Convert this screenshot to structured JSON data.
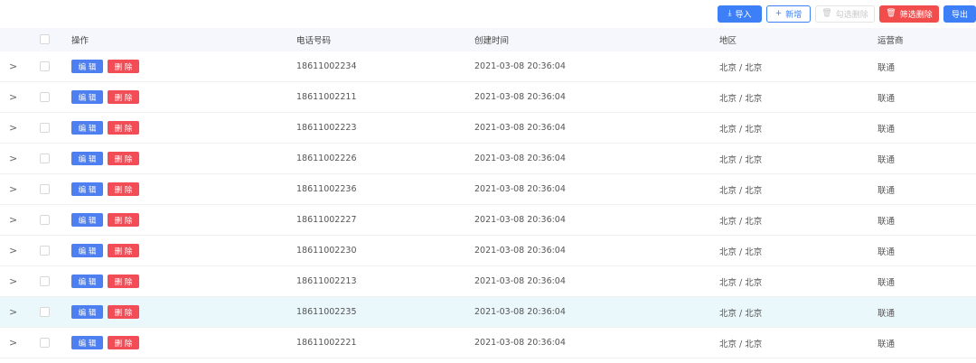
{
  "toolbar": {
    "import_label": "导入",
    "add_label": "新增",
    "checked_delete_label": "勾选删除",
    "filter_delete_label": "筛选删除",
    "export_label": "导出"
  },
  "table": {
    "headers": {
      "ops": "操作",
      "phone": "电话号码",
      "created": "创建时间",
      "region": "地区",
      "carrier": "运营商"
    },
    "edit_label": "编 辑",
    "delete_label": "删 除",
    "rows": [
      {
        "phone": "18611002234",
        "created": "2021-03-08 20:36:04",
        "region": "北京 / 北京",
        "carrier": "联通"
      },
      {
        "phone": "18611002211",
        "created": "2021-03-08 20:36:04",
        "region": "北京 / 北京",
        "carrier": "联通"
      },
      {
        "phone": "18611002223",
        "created": "2021-03-08 20:36:04",
        "region": "北京 / 北京",
        "carrier": "联通"
      },
      {
        "phone": "18611002226",
        "created": "2021-03-08 20:36:04",
        "region": "北京 / 北京",
        "carrier": "联通"
      },
      {
        "phone": "18611002236",
        "created": "2021-03-08 20:36:04",
        "region": "北京 / 北京",
        "carrier": "联通"
      },
      {
        "phone": "18611002227",
        "created": "2021-03-08 20:36:04",
        "region": "北京 / 北京",
        "carrier": "联通"
      },
      {
        "phone": "18611002230",
        "created": "2021-03-08 20:36:04",
        "region": "北京 / 北京",
        "carrier": "联通"
      },
      {
        "phone": "18611002213",
        "created": "2021-03-08 20:36:04",
        "region": "北京 / 北京",
        "carrier": "联通"
      },
      {
        "phone": "18611002235",
        "created": "2021-03-08 20:36:04",
        "region": "北京 / 北京",
        "carrier": "联通"
      },
      {
        "phone": "18611002221",
        "created": "2021-03-08 20:36:04",
        "region": "北京 / 北京",
        "carrier": "联通"
      }
    ],
    "hover_row_index": 8
  },
  "colors": {
    "primary": "#3d7ff6",
    "danger": "#f24d4d",
    "header_bg": "#f5f7fc",
    "hover_bg": "#eaf7fb"
  },
  "icons": {
    "import": "download-icon",
    "add": "plus-icon",
    "delete": "trash-icon",
    "expand": "chevron-right-icon"
  }
}
